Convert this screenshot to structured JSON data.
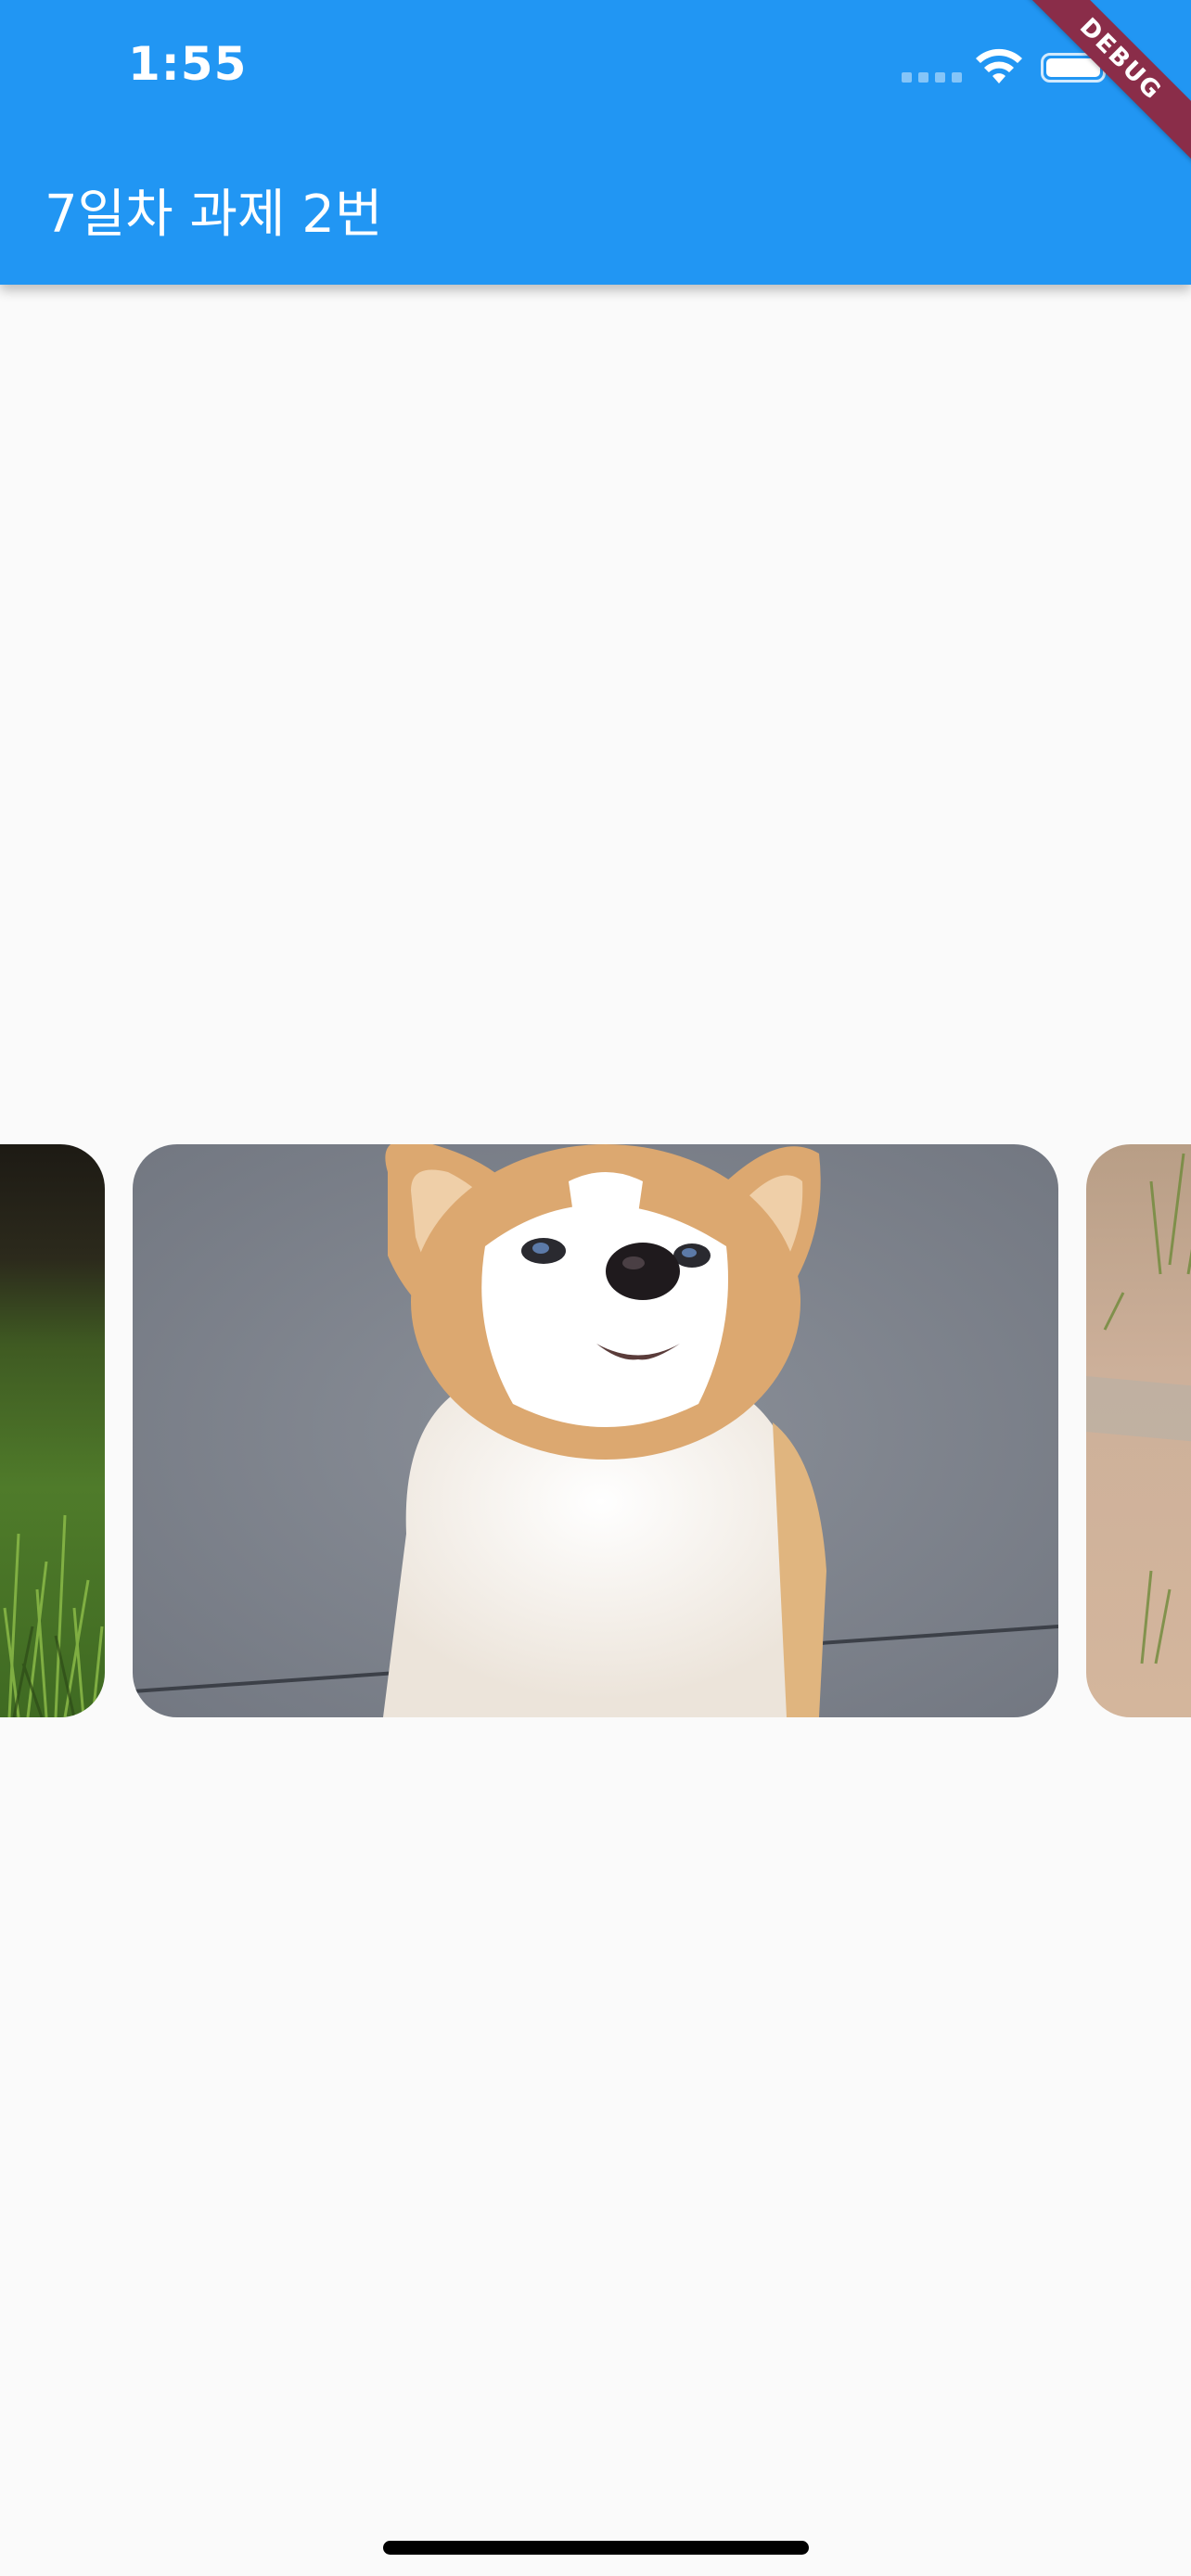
{
  "status_bar": {
    "time": "1:55"
  },
  "app_bar": {
    "title": "7일차 과제 2번",
    "color": "#2196f3"
  },
  "debug_banner": {
    "label": "DEBUG",
    "color": "#8a2d49"
  },
  "carousel": {
    "items": [
      {
        "subject": "grass-photo"
      },
      {
        "subject": "corgi-puppy-photo"
      },
      {
        "subject": "sand-path-photo"
      }
    ]
  }
}
